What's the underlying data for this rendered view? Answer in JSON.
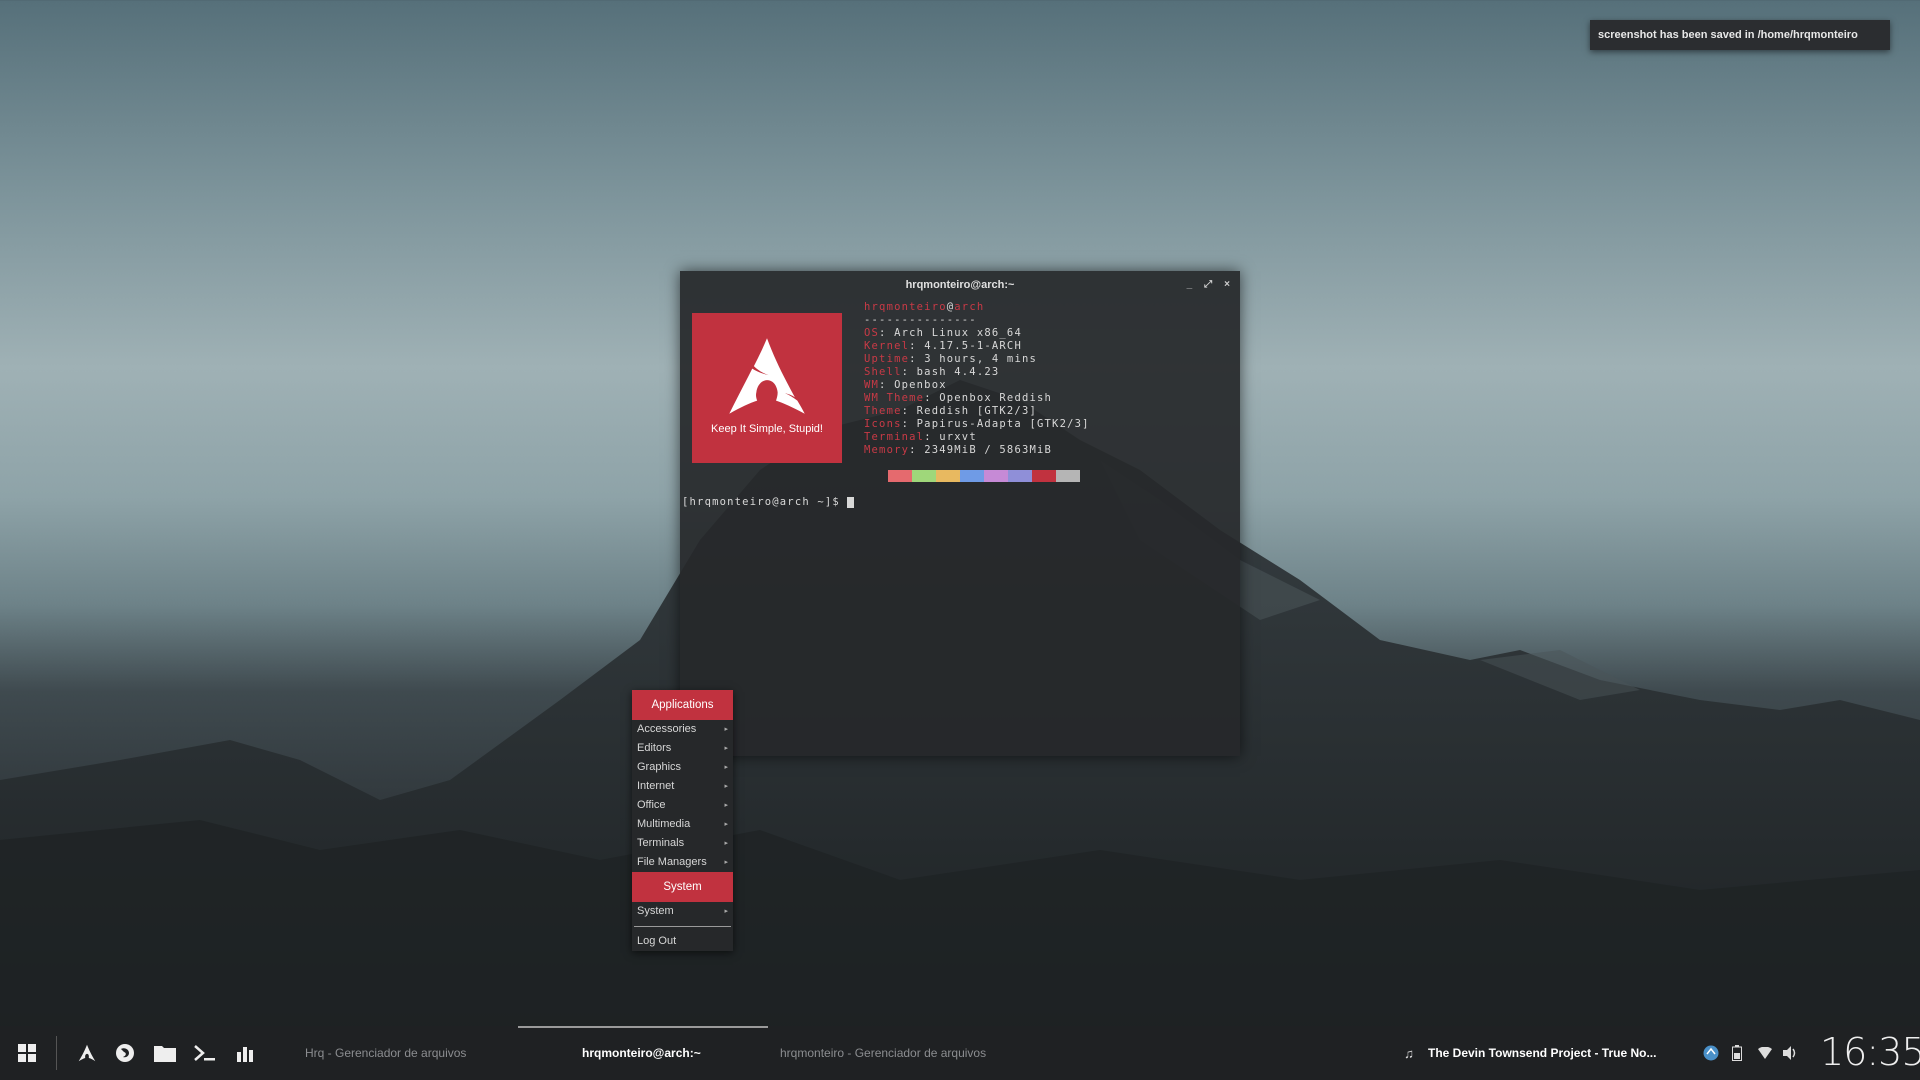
{
  "notification": {
    "text": "screenshot has been saved in /home/hrqmonteiro"
  },
  "terminal": {
    "title": "hrqmonteiro@arch:~",
    "controls": {
      "minimize": "_",
      "maximize": "⤢",
      "close": "×"
    },
    "logo_caption": "Keep It Simple, Stupid!",
    "user": "hrqmonteiro",
    "host": "arch",
    "divider": "---------------",
    "info": [
      {
        "key": "OS",
        "value": "Arch Linux x86_64"
      },
      {
        "key": "Kernel",
        "value": "4.17.5-1-ARCH"
      },
      {
        "key": "Uptime",
        "value": "3 hours, 4 mins"
      },
      {
        "key": "Shell",
        "value": "bash 4.4.23"
      },
      {
        "key": "WM",
        "value": "Openbox"
      },
      {
        "key": "WM Theme",
        "value": "Openbox Reddish"
      },
      {
        "key": "Theme",
        "value": "Reddish [GTK2/3]"
      },
      {
        "key": "Icons",
        "value": "Papirus-Adapta [GTK2/3]"
      },
      {
        "key": "Terminal",
        "value": "urxvt"
      },
      {
        "key": "Memory",
        "value": "2349MiB / 5863MiB"
      }
    ],
    "palette": [
      "#e56a6e",
      "#9fd77a",
      "#e8b960",
      "#6f9be6",
      "#c68ad6",
      "#8f8fd8",
      "#c1323f",
      "#b5b5b5"
    ],
    "prompt": "[hrqmonteiro@arch ~]$ "
  },
  "menu": {
    "header": "Applications",
    "items": [
      "Accessories",
      "Editors",
      "Graphics",
      "Internet",
      "Office",
      "Multimedia",
      "Terminals",
      "File Managers"
    ],
    "system_header": "System",
    "system_item": "System",
    "logout": "Log Out"
  },
  "taskbar": {
    "tasks": [
      {
        "label": "Hrq - Gerenciador de arquivos",
        "active": false
      },
      {
        "label": "hrqmonteiro@arch:~",
        "active": true
      },
      {
        "label": "hrqmonteiro - Gerenciador de arquivos",
        "active": false
      }
    ],
    "now_playing": "The Devin Townsend Project - True No...",
    "clock": "16:35"
  }
}
